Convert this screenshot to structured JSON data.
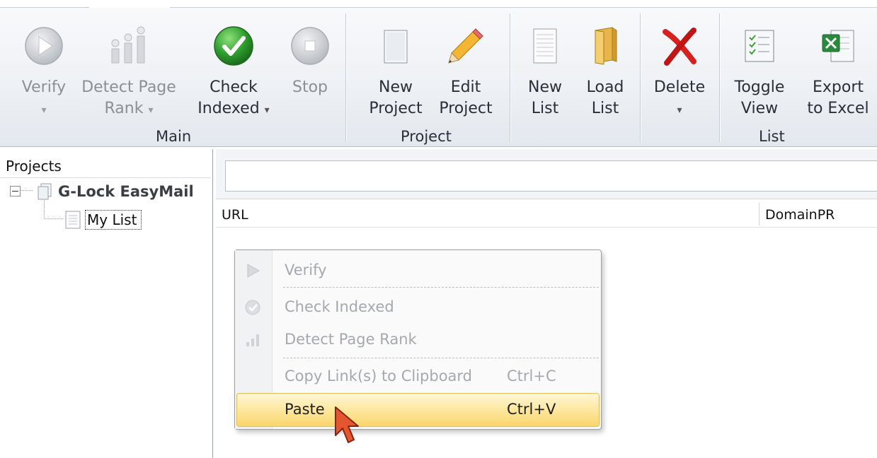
{
  "ribbon": {
    "main": {
      "group_label": "Main",
      "verify": {
        "line1": "Verify"
      },
      "detect_page_rank": {
        "line1": "Detect Page",
        "line2": "Rank"
      },
      "check_indexed": {
        "line1": "Check",
        "line2": "Indexed"
      },
      "stop": {
        "line1": "Stop"
      }
    },
    "project": {
      "group_label": "Project",
      "new_project": {
        "line1": "New",
        "line2": "Project"
      },
      "edit_project": {
        "line1": "Edit",
        "line2": "Project"
      }
    },
    "list": {
      "group_label": "List",
      "new_list": {
        "line1": "New",
        "line2": "List"
      },
      "load_list": {
        "line1": "Load",
        "line2": "List"
      },
      "delete": {
        "line1": "Delete"
      },
      "toggle_view": {
        "line1": "Toggle",
        "line2": "View"
      },
      "export_excel": {
        "line1": "Export",
        "line2": "to Excel"
      }
    },
    "caret": "▾"
  },
  "projects_panel": {
    "header": "Projects",
    "project_name": "G-Lock EasyMail",
    "list_name": "My List"
  },
  "grid": {
    "search_value": "",
    "columns": [
      "URL",
      "DomainPR"
    ]
  },
  "context_menu": {
    "items": [
      {
        "label": "Verify",
        "shortcut": "",
        "enabled": false
      },
      {
        "label": "Check Indexed",
        "shortcut": "",
        "enabled": false
      },
      {
        "label": "Detect Page Rank",
        "shortcut": "",
        "enabled": false
      },
      {
        "label": "Copy Link(s) to Clipboard",
        "shortcut": "Ctrl+C",
        "enabled": false
      },
      {
        "label": "Paste",
        "shortcut": "Ctrl+V",
        "enabled": true,
        "highlighted": true
      }
    ]
  },
  "colors": {
    "highlight": "#fde9a3",
    "check_green": "#2f9e2f",
    "delete_red": "#d8201f",
    "disabled_text": "#a5a8ad"
  }
}
